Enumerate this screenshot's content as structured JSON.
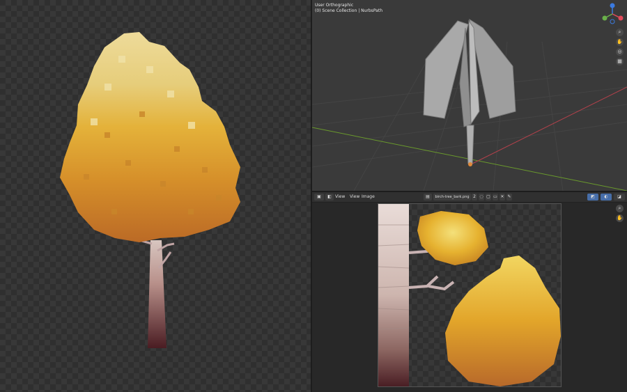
{
  "viewport": {
    "view_name": "User Orthographic",
    "collection": "(0) Scene Collection | NurbsPath",
    "gizmo_axes": [
      "X",
      "Y",
      "Z"
    ]
  },
  "image_editor": {
    "menus": [
      "View",
      "View",
      "Image"
    ],
    "image_name": "birch-tree_bark.png",
    "users_count": "2"
  },
  "icons": {
    "nav": [
      "zoom-icon",
      "hand-icon",
      "camera-icon",
      "grid-icon"
    ],
    "image_nav": [
      "zoom-icon",
      "hand-icon"
    ]
  },
  "colors": {
    "accent": "#476ea8",
    "foliage_light": "#e7cf7e",
    "foliage_mid": "#e2a82a",
    "foliage_dark": "#c97a2b",
    "trunk": "#a06a6a",
    "grid_red": "#b3414b",
    "grid_green": "#6a9a2c"
  }
}
